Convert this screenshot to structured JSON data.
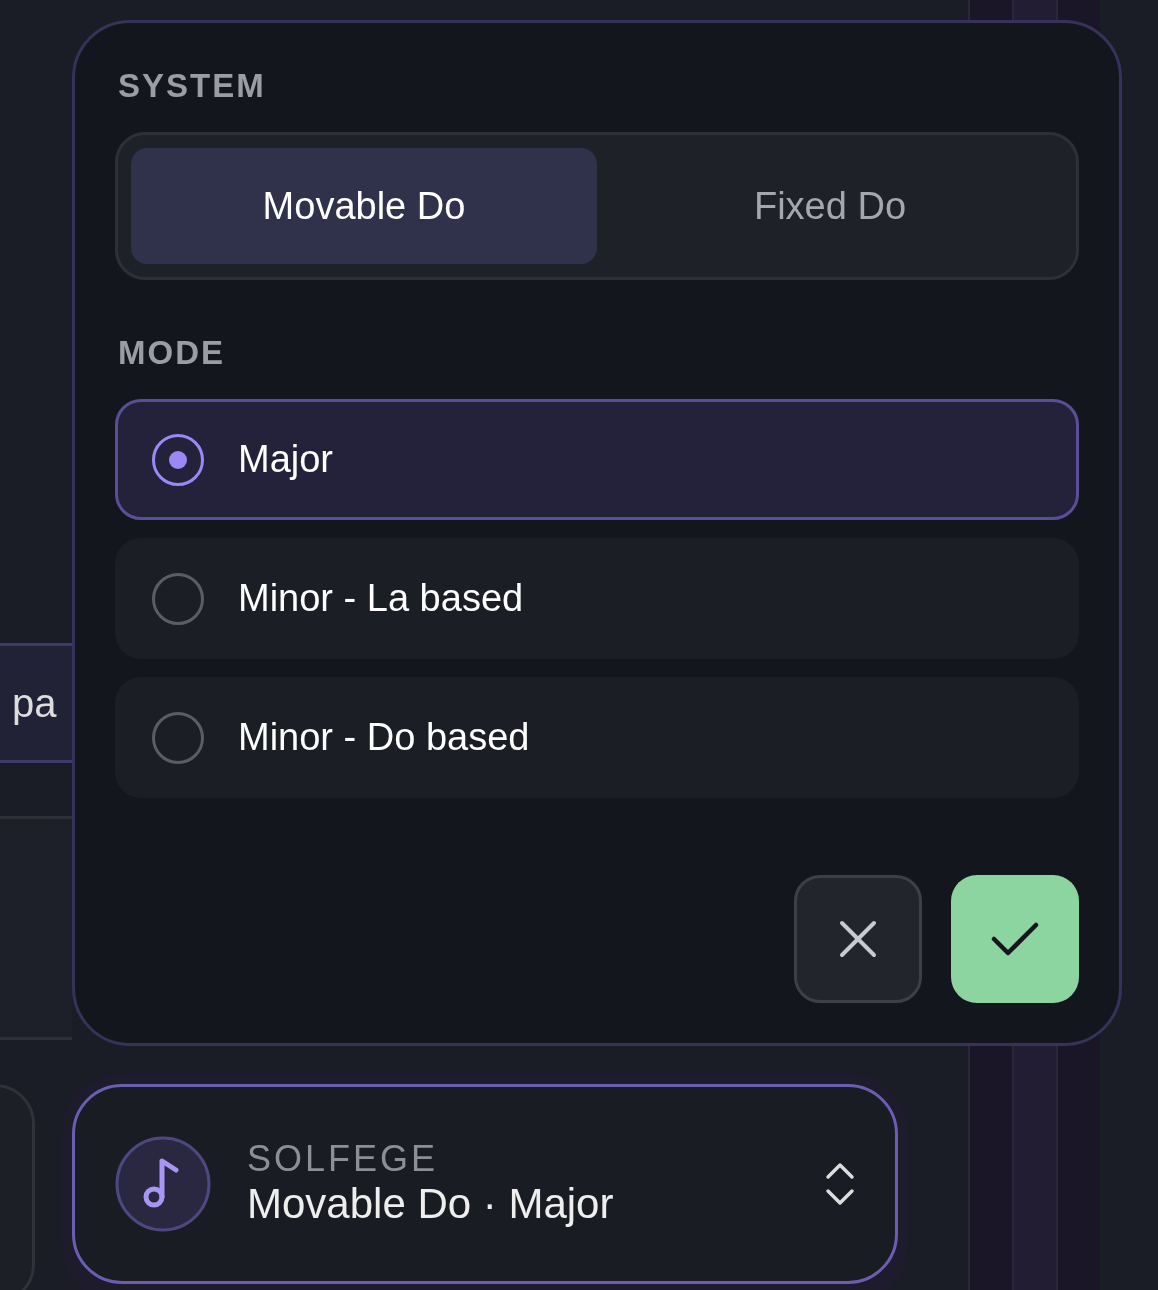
{
  "background_item": {
    "text": "pa"
  },
  "popover": {
    "system_label": "SYSTEM",
    "systems": [
      {
        "label": "Movable Do",
        "selected": true
      },
      {
        "label": "Fixed Do",
        "selected": false
      }
    ],
    "mode_label": "MODE",
    "modes": [
      {
        "label": "Major",
        "selected": true
      },
      {
        "label": "Minor - La based",
        "selected": false
      },
      {
        "label": "Minor - Do based",
        "selected": false
      }
    ],
    "buttons": [
      {
        "kind": "cancel"
      },
      {
        "kind": "confirm"
      }
    ]
  },
  "solfege_button": {
    "label": "SOLFEGE",
    "value": "Movable Do · Major"
  }
}
